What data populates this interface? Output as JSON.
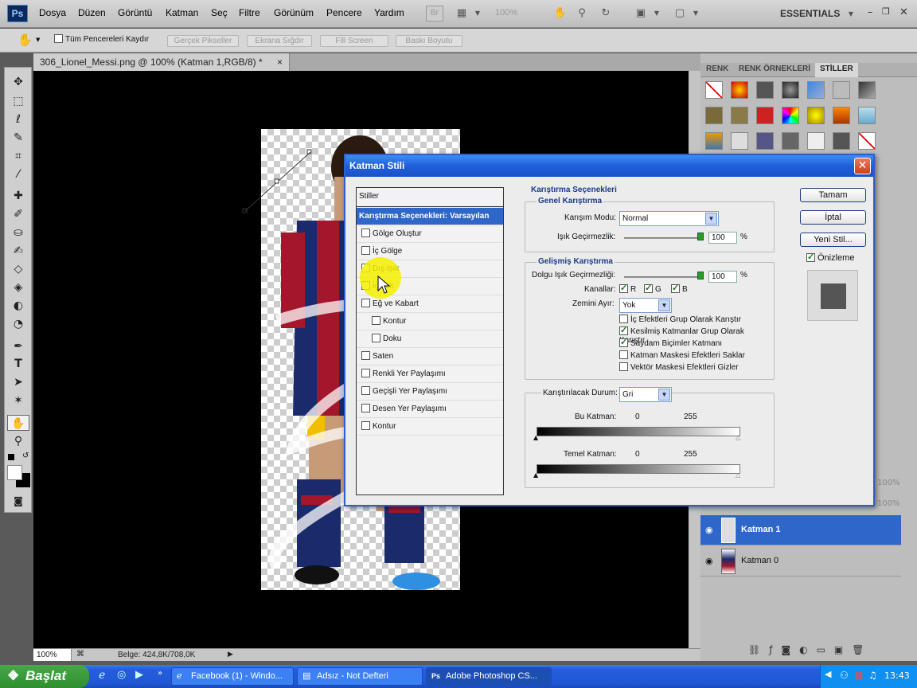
{
  "app": {
    "logo": "Ps",
    "menu": [
      "Dosya",
      "Düzen",
      "Görüntü",
      "Katman",
      "Seç",
      "Filtre",
      "Görünüm",
      "Pencere",
      "Yardım"
    ],
    "bridge": "Br",
    "zoom": "100%",
    "workspace": "ESSENTIALS"
  },
  "options": {
    "scroll_all": "Tüm Pencereleri Kaydır",
    "actual_pixels": "Gerçek Pikseller",
    "fit_screen": "Ekrana Sığdır",
    "fill_screen": "Fill Screen",
    "print_size": "Baskı Boyutu"
  },
  "document": {
    "tab": "306_Lionel_Messi.png @ 100% (Katman 1,RGB/8) *",
    "close": "×",
    "zoom": "100%",
    "info": "Belge: 424,8K/708,0K"
  },
  "panels": {
    "tabs": [
      "RENK",
      "RENK ÖRNEKLERİ",
      "STİLLER"
    ],
    "layers": [
      {
        "name": "Katman 1",
        "selected": true
      },
      {
        "name": "Katman 0",
        "selected": false
      }
    ],
    "percent_a": "100%",
    "percent_b": "100%"
  },
  "dialog": {
    "title": "Katman Stili",
    "styles_header": "Stiller",
    "blend_default": "Karıştırma Seçenekleri: Varsayılan",
    "effects": [
      {
        "label": "Gölge Oluştur",
        "indent": false
      },
      {
        "label": "İç Gölge",
        "indent": false
      },
      {
        "label": "Dış Işık",
        "indent": false
      },
      {
        "label": "İç Işık",
        "indent": false
      },
      {
        "label": "Eğ ve Kabart",
        "indent": false
      },
      {
        "label": "Kontur",
        "indent": true
      },
      {
        "label": "Doku",
        "indent": true
      },
      {
        "label": "Saten",
        "indent": false
      },
      {
        "label": "Renkli Yer Paylaşımı",
        "indent": false
      },
      {
        "label": "Geçişli Yer Paylaşımı",
        "indent": false
      },
      {
        "label": "Desen Yer Paylaşımı",
        "indent": false
      },
      {
        "label": "Kontur",
        "indent": false
      }
    ],
    "blend_options_title": "Karıştırma Seçenekleri",
    "general": {
      "title": "Genel Karıştırma",
      "mode_label": "Karışım Modu:",
      "mode_value": "Normal",
      "opacity_label": "Işık Geçirmezlik:",
      "opacity_value": "100",
      "pct": "%"
    },
    "advanced": {
      "title": "Gelişmiş Karıştırma",
      "fill_label": "Dolgu Işık Geçirmezliği:",
      "fill_value": "100",
      "pct": "%",
      "channels_label": "Kanallar:",
      "channels": [
        "R",
        "G",
        "B"
      ],
      "knockout_label": "Zemini Ayır:",
      "knockout_value": "Yok",
      "options": [
        {
          "label": "İç Efektleri Grup Olarak Karıştır",
          "checked": false
        },
        {
          "label": "Kesilmiş Katmanlar Grup Olarak Karıştır",
          "checked": true
        },
        {
          "label": "Saydam Biçimler Katmanı",
          "checked": true
        },
        {
          "label": "Katman Maskesi Efektleri Saklar",
          "checked": false
        },
        {
          "label": "Vektör Maskesi Efektleri Gizler",
          "checked": false
        }
      ]
    },
    "blend_if": {
      "label": "Karıştırılacak Durum:",
      "value": "Gri",
      "this_layer": "Bu Katman:",
      "underlying": "Temel Katman:",
      "min": "0",
      "max": "255"
    },
    "buttons": {
      "ok": "Tamam",
      "cancel": "İptal",
      "new_style": "Yeni Stil...",
      "preview": "Önizleme"
    }
  },
  "taskbar": {
    "start": "Başlat",
    "tasks": [
      "Facebook (1) - Windo...",
      "Adsız - Not Defteri",
      "Adobe Photoshop CS..."
    ],
    "clock": "13:43"
  },
  "colors": {
    "dialog_title": "#1f5fd9",
    "selected_row": "#2f66c9",
    "accent": "#1a3a8a",
    "highlight": "#f5f000"
  }
}
